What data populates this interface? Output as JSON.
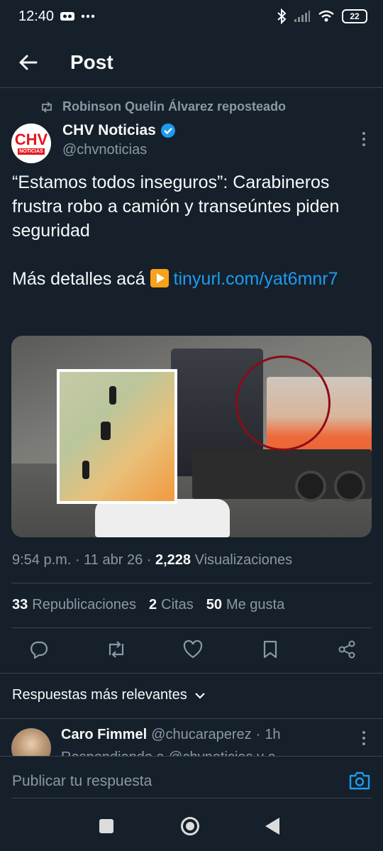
{
  "status_bar": {
    "time": "12:40",
    "battery": "22",
    "icons": [
      "privacy-icon",
      "more-dots-icon",
      "bluetooth-icon",
      "signal-icon",
      "wifi-icon",
      "battery-icon"
    ]
  },
  "header": {
    "title": "Post",
    "back_icon": "arrow-left-icon"
  },
  "post": {
    "repost_label": "Robinson Quelin Álvarez reposteado",
    "author": {
      "name": "CHV Noticias",
      "handle": "@chvnoticias",
      "verified": true,
      "avatar_text": "CHV",
      "avatar_sub": "NOTICIAS"
    },
    "text_line1": "“Estamos todos inseguros”: Carabineros frustra robo a camión y transeúntes piden seguridad",
    "text_line2_prefix": "Más detalles acá",
    "link": "tinyurl.com/yat6mnr7",
    "meta": {
      "time": "9:54 p.m.",
      "date": "11 abr 26",
      "views_count": "2,228",
      "views_label": "Visualizaciones"
    },
    "stats": {
      "reposts_count": "33",
      "reposts_label": "Republicaciones",
      "quotes_count": "2",
      "quotes_label": "Citas",
      "likes_count": "50",
      "likes_label": "Me gusta"
    },
    "actions": [
      "reply-icon",
      "repost-icon",
      "like-icon",
      "bookmark-icon",
      "share-icon"
    ]
  },
  "replies": {
    "sort_label": "Respuestas más relevantes",
    "items": [
      {
        "name": "Caro Fimmel",
        "handle": "@chucaraperez",
        "time": "1h",
        "sub": "Respondiendo a @chvnoticias y a"
      }
    ]
  },
  "compose": {
    "placeholder": "Publicar tu respuesta"
  },
  "colors": {
    "background": "#15202b",
    "text_primary": "#f7f9f9",
    "text_secondary": "#8b98a5",
    "link": "#1d9bf0",
    "divider": "#38444d",
    "verified": "#1d9bf0"
  }
}
